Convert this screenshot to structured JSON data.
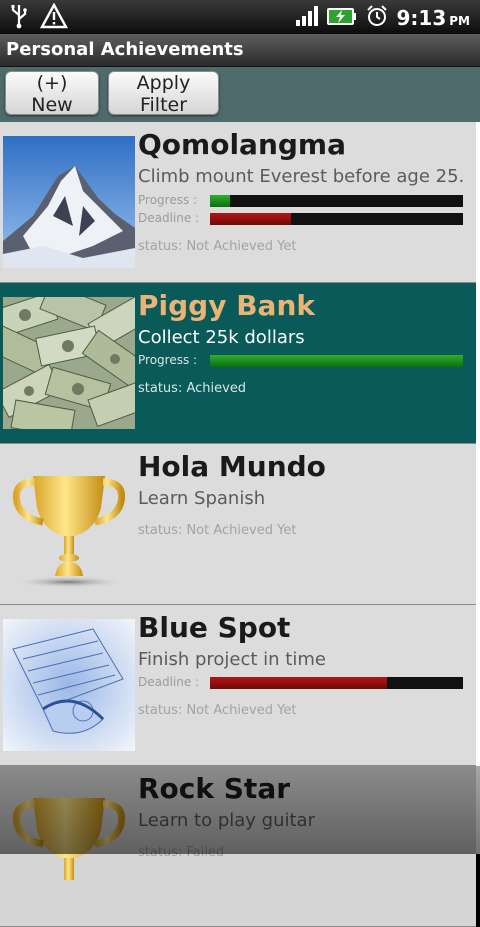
{
  "status_bar": {
    "time": "9:13",
    "ampm": "PM",
    "left_icons": [
      "usb-icon",
      "warning-icon"
    ],
    "right_icons": [
      "signal-icon",
      "battery-charging-icon",
      "alarm-icon"
    ]
  },
  "app": {
    "title": "Personal Achievements"
  },
  "toolbar": {
    "new_label": "(+) New",
    "filter_label": "Apply Filter"
  },
  "labels": {
    "progress": "Progress :",
    "deadline": "Deadline :"
  },
  "items": [
    {
      "title": "Qomolangma",
      "description": "Climb mount Everest before age 25.",
      "progress": 0.08,
      "deadline": 0.32,
      "status": "status: Not Achieved Yet",
      "image": "mountain-image"
    },
    {
      "title": "Piggy Bank",
      "description": "Collect 25k dollars",
      "progress": 1.0,
      "status": "status: Achieved",
      "image": "money-image"
    },
    {
      "title": "Hola Mundo",
      "description": "Learn Spanish",
      "status": "status: Not Achieved Yet",
      "image": "trophy-image"
    },
    {
      "title": "Blue Spot",
      "description": "Finish project in time",
      "deadline": 0.7,
      "status": "status: Not Achieved Yet",
      "image": "blueprint-image"
    },
    {
      "title": "Rock Star",
      "description": "Learn to play guitar",
      "status": "status: Failed",
      "image": "trophy-image"
    }
  ],
  "colors": {
    "selected_bg": "#0a5a5a",
    "selected_title": "#e9b476",
    "progress": "#1f8f1f",
    "deadline": "#8f0f0f"
  }
}
